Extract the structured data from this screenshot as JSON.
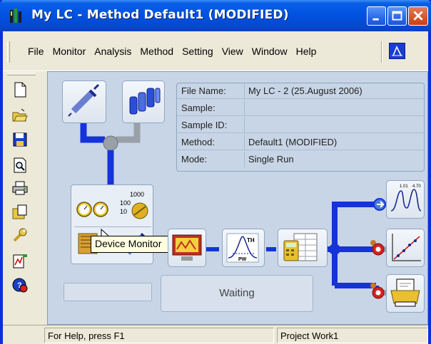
{
  "window": {
    "title": "My LC - Method  Default1 (MODIFIED)"
  },
  "menu": {
    "items": [
      "File",
      "Monitor",
      "Analysis",
      "Method",
      "Setting",
      "View",
      "Window",
      "Help"
    ]
  },
  "toolbar": {
    "icons": [
      "new-document-icon",
      "open-folder-icon",
      "save-icon",
      "print-preview-icon",
      "print-icon",
      "copy-icon",
      "wrench-icon",
      "chart-edit-icon",
      "help-icon"
    ]
  },
  "info_panel": {
    "rows": [
      {
        "label": "File Name:",
        "value": "My LC - 2 (25.August 2006)"
      },
      {
        "label": "Sample:",
        "value": ""
      },
      {
        "label": "Sample ID:",
        "value": ""
      },
      {
        "label": "Method:",
        "value": "Default1 (MODIFIED)"
      },
      {
        "label": "Mode:",
        "value": "Single Run"
      }
    ]
  },
  "device_gauge_numbers": [
    "1000",
    "100",
    "10"
  ],
  "status": {
    "text": "Waiting"
  },
  "tooltip": {
    "text": "Device Monitor"
  },
  "statusbar": {
    "help": "For Help, press F1",
    "project": "Project Work1"
  },
  "colors": {
    "titlebar": "#0053e1",
    "pipe_blue": "#1533d6",
    "pipe_gray": "#9aa0a8",
    "canvas": "#c8d5e6",
    "tooltip_bg": "#ffffe1"
  }
}
